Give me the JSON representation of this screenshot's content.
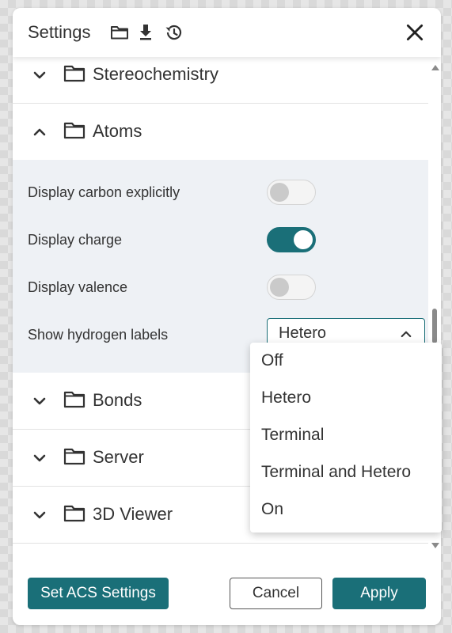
{
  "dialog": {
    "title": "Settings",
    "header_icons": [
      "folder-open-icon",
      "download-icon",
      "history-icon"
    ],
    "close_icon": "close-icon"
  },
  "sections": {
    "stereochemistry": {
      "label": "Stereochemistry",
      "expanded": false
    },
    "atoms": {
      "label": "Atoms",
      "expanded": true
    },
    "bonds": {
      "label": "Bonds",
      "expanded": false
    },
    "server": {
      "label": "Server",
      "expanded": false
    },
    "viewer3d": {
      "label": "3D Viewer",
      "expanded": false
    }
  },
  "atoms_options": {
    "display_carbon": {
      "label": "Display carbon explicitly",
      "on": false
    },
    "display_charge": {
      "label": "Display charge",
      "on": true
    },
    "display_valence": {
      "label": "Display valence",
      "on": false
    },
    "show_hydrogen": {
      "label": "Show hydrogen labels",
      "value": "Hetero"
    }
  },
  "dropdown": {
    "open": true,
    "options": [
      "Off",
      "Hetero",
      "Terminal",
      "Terminal and Hetero",
      "On"
    ]
  },
  "footer": {
    "acs_label": "Set ACS Settings",
    "cancel_label": "Cancel",
    "apply_label": "Apply"
  },
  "colors": {
    "accent": "#1a6f78",
    "panel_bg": "#eef1f5",
    "toggle_off": "#cacaca"
  }
}
